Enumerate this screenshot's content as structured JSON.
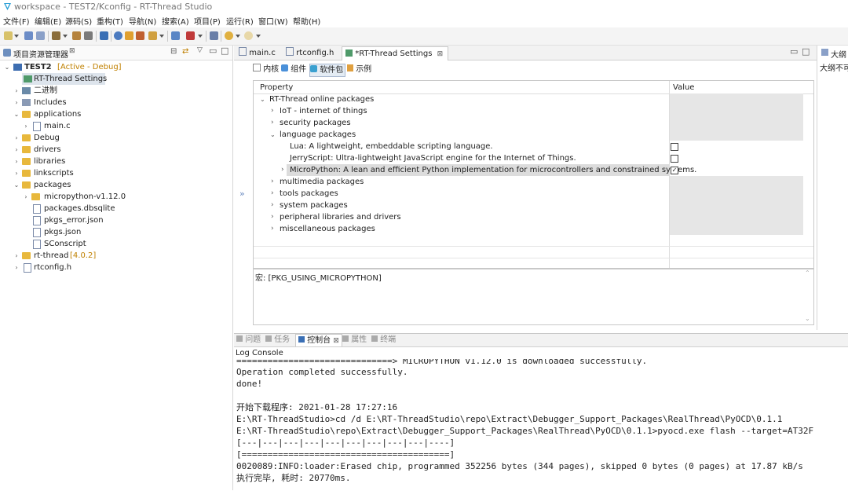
{
  "window": {
    "title": "workspace - TEST2/Kconfig - RT-Thread Studio"
  },
  "menu": [
    "文件(F)",
    "编辑(E)",
    "源码(S)",
    "重构(T)",
    "导航(N)",
    "搜索(A)",
    "项目(P)",
    "运行(R)",
    "窗口(W)",
    "帮助(H)"
  ],
  "explorer": {
    "title": "项目资源管理器",
    "project": "TEST2",
    "project_status": "[Active - Debug]",
    "items": [
      {
        "label": "RT-Thread Settings"
      },
      {
        "label": "二进制"
      },
      {
        "label": "Includes"
      },
      {
        "label": "applications"
      },
      {
        "label": "main.c"
      },
      {
        "label": "Debug"
      },
      {
        "label": "drivers"
      },
      {
        "label": "libraries"
      },
      {
        "label": "linkscripts"
      },
      {
        "label": "packages"
      },
      {
        "label": "micropython-v1.12.0"
      },
      {
        "label": "packages.dbsqlite"
      },
      {
        "label": "pkgs_error.json"
      },
      {
        "label": "pkgs.json"
      },
      {
        "label": "SConscript"
      },
      {
        "label": "rt-thread",
        "suffix": "[4.0.2]"
      },
      {
        "label": "rtconfig.h"
      }
    ]
  },
  "editor": {
    "tabs": [
      "main.c",
      "rtconfig.h",
      "*RT-Thread Settings"
    ],
    "subtabs": [
      "内核",
      "组件",
      "软件包",
      "示例"
    ],
    "table": {
      "col_property": "Property",
      "col_value": "Value",
      "rows": [
        {
          "label": "RT-Thread online packages"
        },
        {
          "label": "IoT - internet of things"
        },
        {
          "label": "security packages"
        },
        {
          "label": "language packages"
        },
        {
          "label": "Lua: A lightweight, embeddable scripting language.",
          "checked": false
        },
        {
          "label": "JerryScript: Ultra-lightweight JavaScript engine for the Internet of Things.",
          "checked": false
        },
        {
          "label": "MicroPython: A lean and efficient Python implementation for microcontrollers and constrained systems.",
          "checked": true
        },
        {
          "label": "multimedia packages"
        },
        {
          "label": "tools packages"
        },
        {
          "label": "system packages"
        },
        {
          "label": "peripheral libraries and drivers"
        },
        {
          "label": "miscellaneous packages"
        }
      ]
    },
    "macro": "宏: [PKG_USING_MICROPYTHON]"
  },
  "outline": {
    "title": "大纲",
    "text": "大纲不可"
  },
  "console": {
    "tabs": [
      "问题",
      "任务",
      "控制台",
      "属性",
      "终端"
    ],
    "name": "Log Console",
    "lines": [
      "==============================>  MICROPYTHON v1.12.0 is downloaded successfully.",
      "Operation completed successfully.",
      "done!",
      "",
      "开始下载程序: 2021-01-28 17:27:16",
      "E:\\RT-ThreadStudio>cd /d E:\\RT-ThreadStudio\\repo\\Extract\\Debugger_Support_Packages\\RealThread\\PyOCD\\0.1.1",
      "E:\\RT-ThreadStudio\\repo\\Extract\\Debugger_Support_Packages\\RealThread\\PyOCD\\0.1.1>pyocd.exe flash --target=AT32F",
      "[---|---|---|---|---|---|---|---|---|----]",
      "[========================================]",
      "0020089:INFO:loader:Erased chip, programmed 352256 bytes (344 pages), skipped 0 bytes (0 pages) at 17.87 kB/s",
      "执行完毕, 耗时: 20770ms."
    ]
  }
}
